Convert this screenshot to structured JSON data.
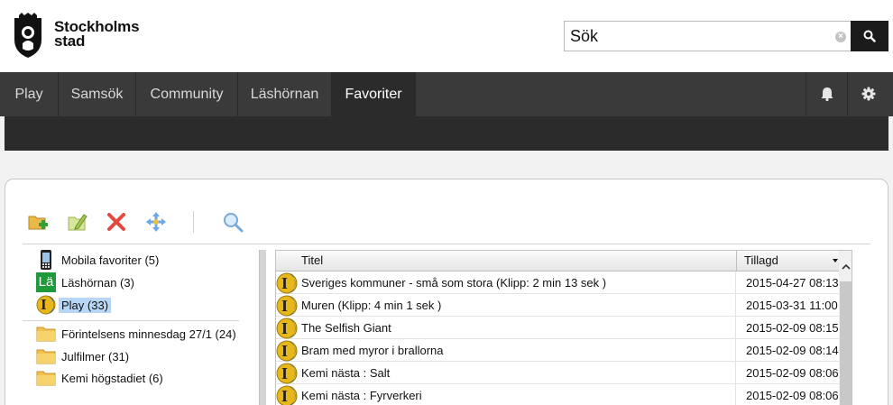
{
  "header": {
    "brand_line1": "Stockholms",
    "brand_line2": "stad",
    "search_value": "Sök",
    "clear_glyph": "×"
  },
  "nav": {
    "tabs": [
      {
        "label": "Play"
      },
      {
        "label": "Samsök"
      },
      {
        "label": "Community"
      },
      {
        "label": "Läshörnan"
      },
      {
        "label": "Favoriter",
        "active": true
      }
    ],
    "icons": [
      "bell-icon",
      "gear-icon"
    ]
  },
  "toolbar": {
    "buttons": [
      "new-folder-icon",
      "edit-folder-icon",
      "delete-icon",
      "move-icon",
      "search-icon"
    ]
  },
  "tree": {
    "items": [
      {
        "label": "Mobila favoriter (5)",
        "icon": "phone-icon"
      },
      {
        "label": "Läshörnan (3)",
        "icon": "lashornan-icon",
        "icon_text": "Lä"
      },
      {
        "label": "Play (33)",
        "icon": "play-icon",
        "icon_text": "I",
        "selected": true
      },
      {
        "label": "Förintelsens minnesdag 27/1 (24)",
        "icon": "folder-icon"
      },
      {
        "label": "Julfilmer (31)",
        "icon": "folder-icon"
      },
      {
        "label": "Kemi högstadiet (6)",
        "icon": "folder-icon"
      }
    ]
  },
  "grid": {
    "columns": {
      "title": "Titel",
      "added": "Tillagd"
    },
    "sort": "descending",
    "rows": [
      {
        "title": "Sveriges kommuner - små som stora (Klipp: 2 min 13 sek )",
        "added": "2015-04-27 08:13"
      },
      {
        "title": "Muren (Klipp: 4 min 1 sek )",
        "added": "2015-03-31 11:00"
      },
      {
        "title": "The Selfish Giant",
        "added": "2015-02-09 08:15"
      },
      {
        "title": "Bram med myror i brallorna",
        "added": "2015-02-09 08:14"
      },
      {
        "title": "Kemi nästa : Salt",
        "added": "2015-02-09 08:06"
      },
      {
        "title": "Kemi nästa : Fyrverkeri",
        "added": "2015-02-09 08:06"
      }
    ],
    "icon_text": "I"
  },
  "colors": {
    "nav_bg": "#3a3a3a",
    "nav_active": "#2b2b2b",
    "selection": "#b8d6f5",
    "play_icon_gold": "#e8b81a",
    "play_icon_blue": "#1a5fb4"
  }
}
